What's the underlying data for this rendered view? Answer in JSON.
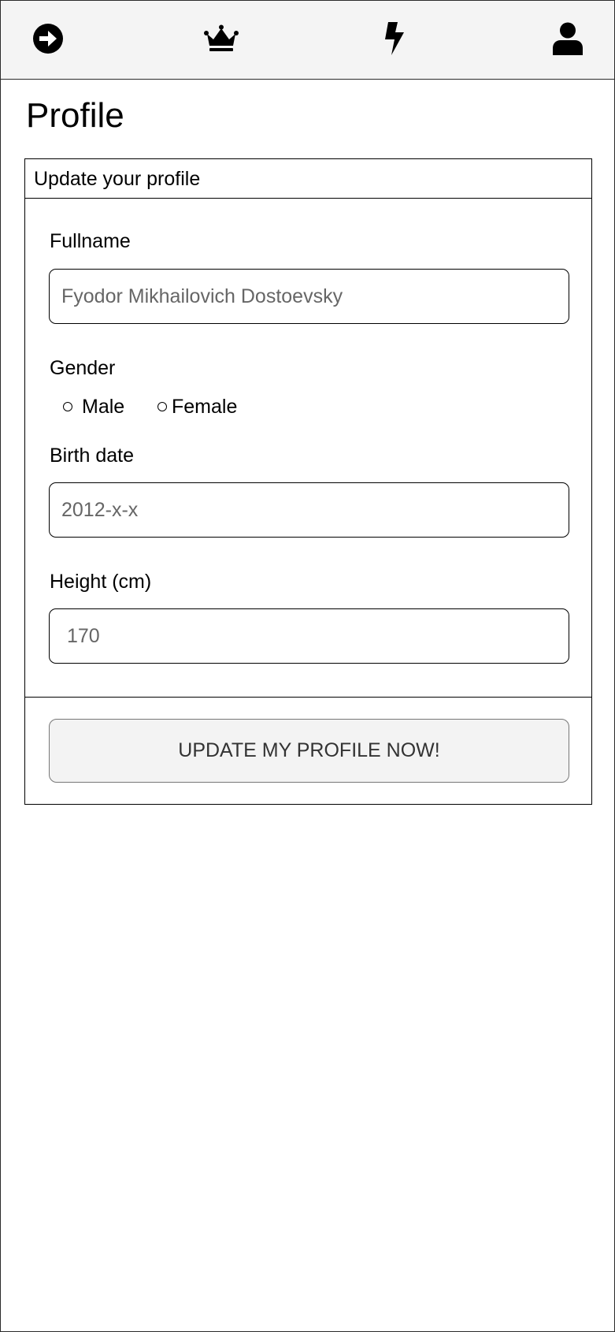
{
  "nav": {
    "icons": [
      "arrow-circle-right-icon",
      "crown-icon",
      "bolt-icon",
      "user-icon"
    ],
    "bar_color": "#f4f4f4"
  },
  "page": {
    "title": "Profile"
  },
  "form": {
    "header": "Update your profile",
    "fullname": {
      "label": "Fullname",
      "placeholder": "Fyodor Mikhailovich Dostoevsky"
    },
    "gender": {
      "label": "Gender",
      "options": [
        "Male",
        "Female"
      ]
    },
    "birth_date": {
      "label": "Birth date",
      "placeholder": "2012-x-x"
    },
    "height": {
      "label": "Height (cm)",
      "placeholder": "170"
    },
    "submit_label": "UPDATE MY PROFILE NOW!"
  }
}
